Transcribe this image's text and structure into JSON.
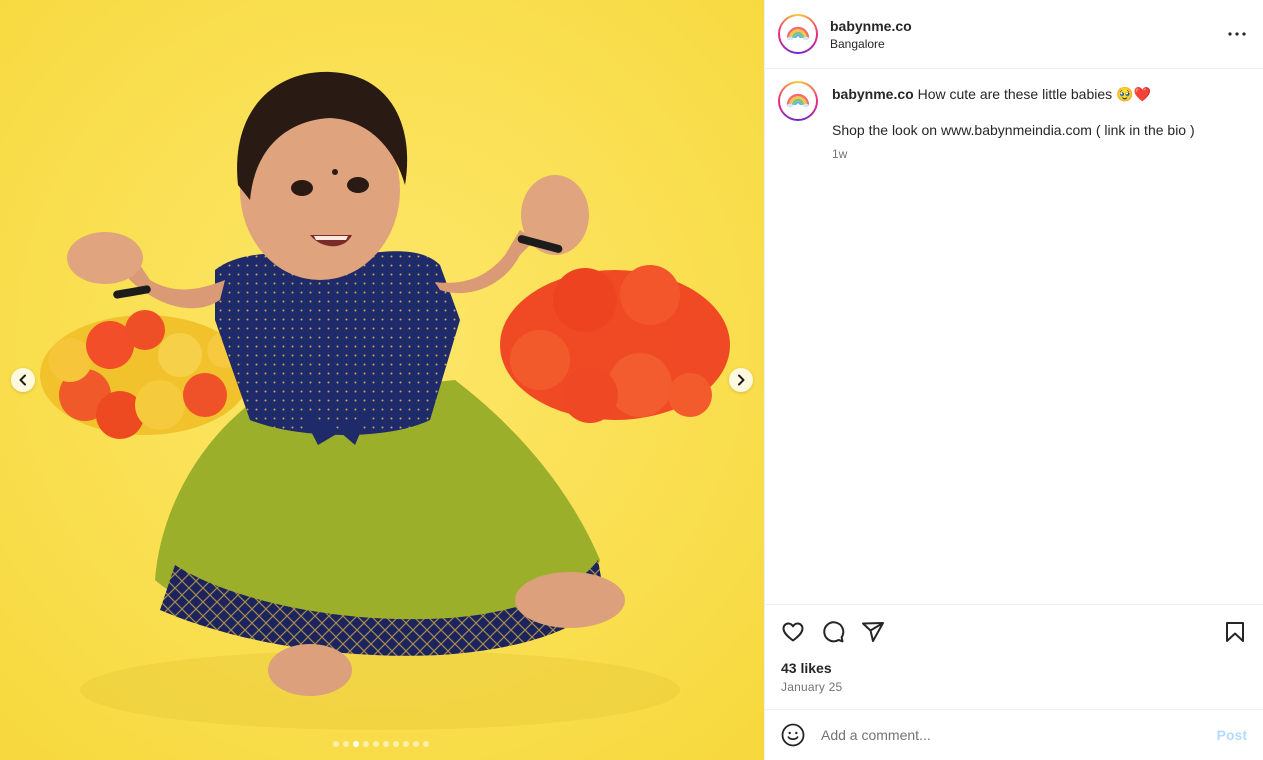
{
  "post": {
    "username": "babynme.co",
    "location": "Bangalore",
    "caption_text": "How cute are these little babies 🥹❤️",
    "caption_line2": "Shop the look on www.babynmeindia.com ( link in the bio )",
    "time_ago": "1w",
    "likes": "43 likes",
    "date": "January 25"
  },
  "comment_box": {
    "placeholder": "Add a comment...",
    "post_label": "Post"
  },
  "carousel": {
    "slide_count": 10,
    "active_index": 2
  },
  "icons": {
    "prev": "chevron-left-icon",
    "next": "chevron-right-icon",
    "more": "more-horizontal-icon",
    "like": "heart-icon",
    "comment": "comment-bubble-icon",
    "share": "paper-plane-icon",
    "save": "bookmark-icon",
    "emoji": "smiley-icon"
  },
  "colors": {
    "photo_background": "#fbe04d",
    "post_button_disabled": "#b3dbff"
  }
}
